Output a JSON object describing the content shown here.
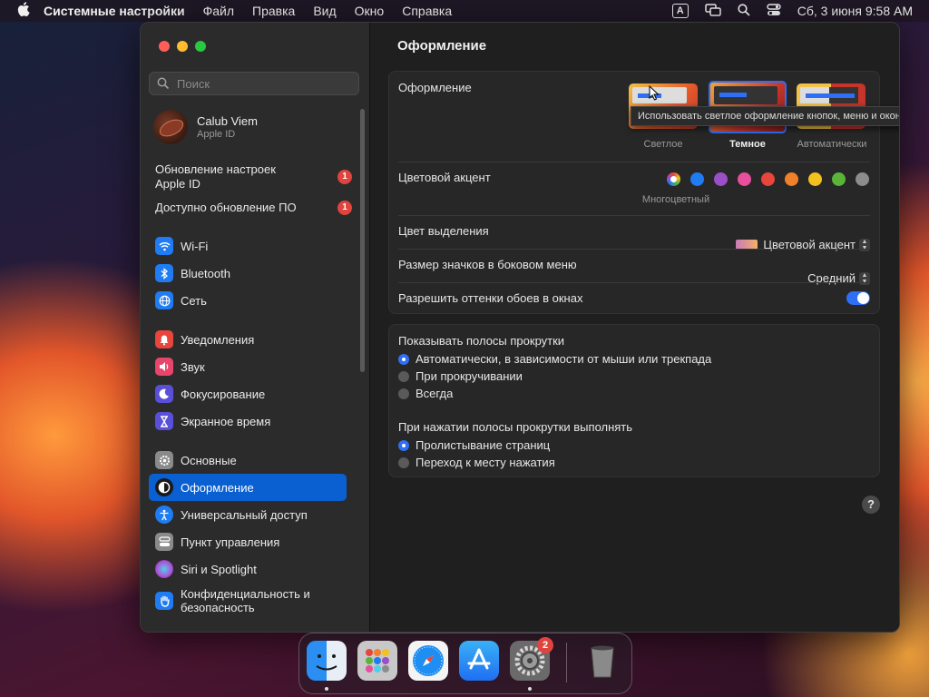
{
  "menubar": {
    "app_name": "Системные настройки",
    "items": [
      "Файл",
      "Правка",
      "Вид",
      "Окно",
      "Справка"
    ],
    "input_source": "A",
    "datetime": "Сб, 3 июня  9:58 AM"
  },
  "sidebar": {
    "search_placeholder": "Поиск",
    "profile": {
      "name": "Calub Viem",
      "sub": "Apple ID"
    },
    "updates": [
      {
        "label": "Обновление настроек Apple ID",
        "badge": "1"
      },
      {
        "label": "Доступно обновление ПО",
        "badge": "1"
      }
    ],
    "items": [
      {
        "label": "Wi-Fi",
        "icon": "wifi-icon",
        "color": "#1f7cf2"
      },
      {
        "label": "Bluetooth",
        "icon": "bluetooth-icon",
        "color": "#1f7cf2"
      },
      {
        "label": "Сеть",
        "icon": "globe-icon",
        "color": "#1f7cf2"
      },
      {
        "label": "Уведомления",
        "icon": "bell-icon",
        "color": "#e8453c"
      },
      {
        "label": "Звук",
        "icon": "speaker-icon",
        "color": "#e8456a"
      },
      {
        "label": "Фокусирование",
        "icon": "moon-icon",
        "color": "#5a4fd8"
      },
      {
        "label": "Экранное время",
        "icon": "hourglass-icon",
        "color": "#5a4fd8"
      },
      {
        "label": "Основные",
        "icon": "gear-icon",
        "color": "#8a8a8a"
      },
      {
        "label": "Оформление",
        "icon": "appearance-icon",
        "color": "#1a1a1a"
      },
      {
        "label": "Универсальный доступ",
        "icon": "accessibility-icon",
        "color": "#1f7cf2"
      },
      {
        "label": "Пункт управления",
        "icon": "control-center-icon",
        "color": "#8a8a8a"
      },
      {
        "label": "Siri и Spotlight",
        "icon": "siri-icon",
        "color": "#b04fd8"
      },
      {
        "label": "Конфиденциальность и безопасность",
        "icon": "hand-icon",
        "color": "#1f7cf2"
      }
    ]
  },
  "main": {
    "title": "Оформление",
    "appearance_label": "Оформление",
    "modes": [
      "Светлое",
      "Темное",
      "Автоматически"
    ],
    "tooltip": "Использовать светлое оформление кнопок, меню и окон.",
    "accent_label": "Цветовой акцент",
    "accent_colors": [
      "#1f7cf2",
      "#9a4fc7",
      "#e84f9c",
      "#e8453c",
      "#f0812a",
      "#f2c21e",
      "#5ab43a",
      "#8c8c8c"
    ],
    "accent_caption": "Многоцветный",
    "highlight_label": "Цвет выделения",
    "highlight_value": "Цветовой акцент",
    "icon_size_label": "Размер значков в боковом меню",
    "icon_size_value": "Средний",
    "tint_label": "Разрешить оттенки обоев в окнах",
    "scroll_label": "Показывать полосы прокрутки",
    "scroll_options": [
      "Автоматически, в зависимости от мыши или трекпада",
      "При прокручивании",
      "Всегда"
    ],
    "click_label": "При нажатии полосы прокрутки выполнять",
    "click_options": [
      "Пролистывание страниц",
      "Переход к месту нажатия"
    ],
    "help": "?"
  },
  "dock": {
    "badge": "2"
  }
}
